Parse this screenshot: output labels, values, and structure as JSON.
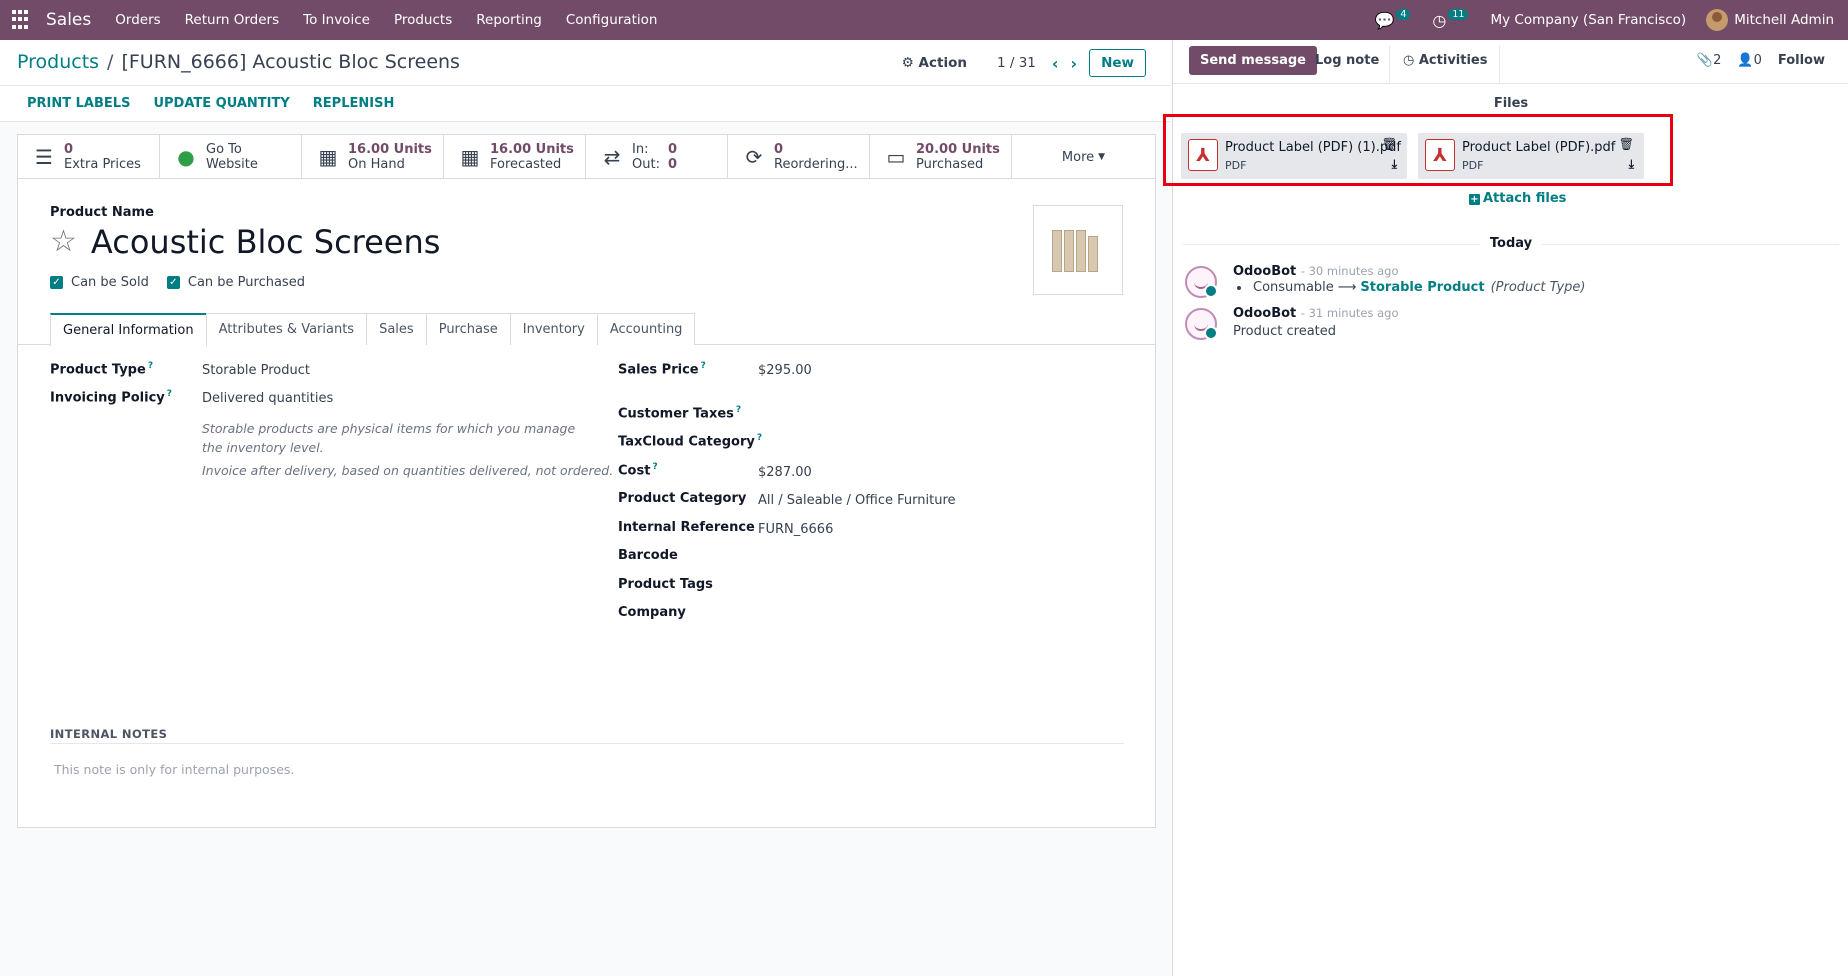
{
  "navbar": {
    "app_name": "Sales",
    "menu": [
      "Orders",
      "Return Orders",
      "To Invoice",
      "Products",
      "Reporting",
      "Configuration"
    ],
    "chat_count": "4",
    "activity_count": "11",
    "company": "My Company (San Francisco)",
    "user": "Mitchell Admin"
  },
  "control_panel": {
    "breadcrumb_root": "Products",
    "breadcrumb_current": "[FURN_6666] Acoustic Bloc Screens",
    "action_label": "Action",
    "pager": "1 / 31",
    "new_label": "New"
  },
  "action_buttons": [
    "PRINT LABELS",
    "UPDATE QUANTITY",
    "REPLENISH"
  ],
  "stat_buttons": {
    "extra_prices": {
      "value": "0",
      "label": "Extra Prices"
    },
    "website": {
      "value": "Go To",
      "label": "Website"
    },
    "on_hand": {
      "value": "16.00 Units",
      "label": "On Hand"
    },
    "forecasted": {
      "value": "16.00 Units",
      "label": "Forecasted"
    },
    "in_out": {
      "in_label": "In:",
      "in_value": "0",
      "out_label": "Out:",
      "out_value": "0"
    },
    "reordering": {
      "value": "0",
      "label": "Reordering..."
    },
    "purchased": {
      "value": "20.00 Units",
      "label": "Purchased"
    },
    "more": "More"
  },
  "product": {
    "name_label": "Product Name",
    "name": "Acoustic Bloc Screens",
    "can_be_sold": "Can be Sold",
    "can_be_purchased": "Can be Purchased"
  },
  "tabs": [
    "General Information",
    "Attributes & Variants",
    "Sales",
    "Purchase",
    "Inventory",
    "Accounting"
  ],
  "general": {
    "product_type_label": "Product Type",
    "product_type": "Storable Product",
    "invoicing_policy_label": "Invoicing Policy",
    "invoicing_policy": "Delivered quantities",
    "help_storable": "Storable products are physical items for which you manage the inventory level.",
    "help_invoice": "Invoice after delivery, based on quantities delivered, not ordered.",
    "sales_price_label": "Sales Price",
    "sales_price": "$295.00",
    "customer_taxes_label": "Customer Taxes",
    "taxcloud_label": "TaxCloud Category",
    "cost_label": "Cost",
    "cost": "$287.00",
    "category_label": "Product Category",
    "category": "All / Saleable / Office Furniture",
    "internal_ref_label": "Internal Reference",
    "internal_ref": "FURN_6666",
    "barcode_label": "Barcode",
    "tags_label": "Product Tags",
    "company_label": "Company"
  },
  "internal_notes": {
    "label": "INTERNAL NOTES",
    "placeholder": "This note is only for internal purposes."
  },
  "chatter": {
    "send_message": "Send message",
    "log_note": "Log note",
    "activities": "Activities",
    "attachments_count": "2",
    "followers_count": "0",
    "follow": "Follow",
    "files_title": "Files",
    "attachments": [
      {
        "name": "Product Label (PDF) (1).pdf",
        "type": "PDF"
      },
      {
        "name": "Product Label (PDF).pdf",
        "type": "PDF"
      }
    ],
    "attach_files": "Attach files",
    "today": "Today",
    "messages": [
      {
        "author": "OdooBot",
        "time": "- 30 minutes ago",
        "old_value": "Consumable",
        "new_value": "Storable Product",
        "field": "(Product Type)"
      },
      {
        "author": "OdooBot",
        "time": "- 31 minutes ago",
        "body": "Product created"
      }
    ]
  },
  "colors": {
    "brand": "#714b67",
    "accent": "#017e84",
    "highlight": "#e60012"
  }
}
